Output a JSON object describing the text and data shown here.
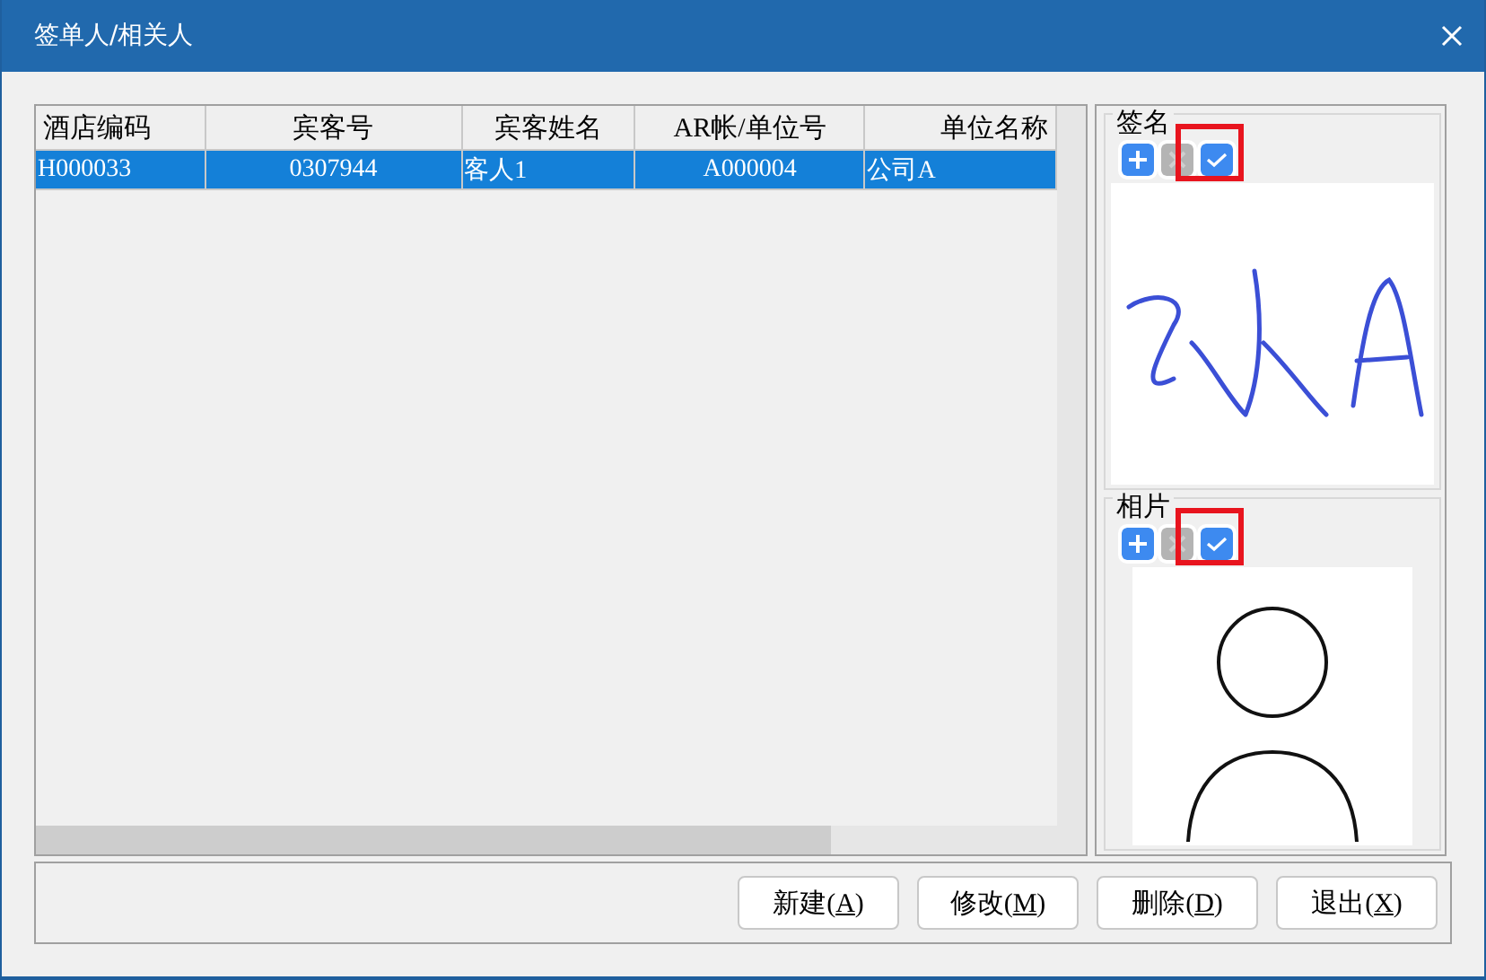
{
  "window": {
    "title": "签单人/相关人"
  },
  "table": {
    "columns": [
      "酒店编码",
      "宾客号",
      "宾客姓名",
      "AR帐/单位号",
      "单位名称"
    ],
    "rows": [
      {
        "selected": true,
        "cells": [
          "H000033",
          "0307944",
          "客人1",
          "A000004",
          "公司A"
        ]
      }
    ]
  },
  "groups": [
    {
      "title": "签名",
      "kind": "signature",
      "tools": [
        {
          "kind": "add",
          "disabled": false,
          "highlighted": false
        },
        {
          "kind": "remove",
          "disabled": true,
          "highlighted": false
        },
        {
          "kind": "confirm",
          "disabled": false,
          "highlighted": true
        }
      ]
    },
    {
      "title": "相片",
      "kind": "photo",
      "tools": [
        {
          "kind": "add",
          "disabled": false,
          "highlighted": false
        },
        {
          "kind": "remove",
          "disabled": true,
          "highlighted": false
        },
        {
          "kind": "confirm",
          "disabled": false,
          "highlighted": true
        }
      ]
    }
  ],
  "buttons": [
    {
      "before": "新建(",
      "key": "A",
      "after": ")"
    },
    {
      "before": "修改(",
      "key": "M",
      "after": ")"
    },
    {
      "before": "删除(",
      "key": "D",
      "after": ")"
    },
    {
      "before": "退出(",
      "key": "X",
      "after": ")"
    }
  ]
}
